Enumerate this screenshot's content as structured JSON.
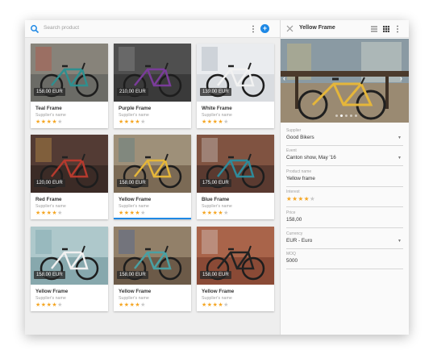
{
  "search": {
    "placeholder": "Search product"
  },
  "icons": {
    "search": "search-icon",
    "more": "more-vert-icon",
    "add": "add-circle-icon",
    "close": "close-icon",
    "list": "list-view-icon",
    "grid": "grid-view-icon"
  },
  "colors": {
    "accent": "#1e88e5",
    "star": "#f5a623",
    "star_off": "#c9c9c9"
  },
  "add_label": "+",
  "products": [
    {
      "price": "158,00 EUR",
      "title": "Teal Frame",
      "supplier": "Supplier's name",
      "rating": 4
    },
    {
      "price": "210,00 EUR",
      "title": "Purple Frame",
      "supplier": "Supplier's name",
      "rating": 4
    },
    {
      "price": "139,00 EUR",
      "title": "White Frame",
      "supplier": "Supplier's name",
      "rating": 4
    },
    {
      "price": "120,00 EUR",
      "title": "Red Frame",
      "supplier": "Supplier's name",
      "rating": 4
    },
    {
      "price": "158,00 EUR",
      "title": "Yellow Frame",
      "supplier": "Supplier's name",
      "rating": 4
    },
    {
      "price": "175,00 EUR",
      "title": "Blue Frame",
      "supplier": "Supplier's name",
      "rating": 4
    },
    {
      "price": "158,00 EUR",
      "title": "Yellow Frame",
      "supplier": "Supplier's name",
      "rating": 4
    },
    {
      "price": "158,00 EUR",
      "title": "Yellow Frame",
      "supplier": "Supplier's name",
      "rating": 4
    },
    {
      "price": "158,00 EUR",
      "title": "Yellow Frame",
      "supplier": "Supplier's name",
      "rating": 4
    }
  ],
  "selected_index": 4,
  "detail": {
    "title": "Yellow Frame",
    "nav_prev": "‹",
    "nav_next": "›",
    "carousel_count": 5,
    "carousel_active": 1,
    "fields": [
      {
        "label": "Supplier",
        "value": "Good Bikers",
        "dropdown": true
      },
      {
        "label": "Event",
        "value": "Canton show, May '16",
        "dropdown": true
      },
      {
        "label": "Product name",
        "value": "Yellow frame",
        "dropdown": false
      },
      {
        "label": "Interest",
        "rating": 4,
        "dropdown": false
      },
      {
        "label": "Price",
        "value": "158,00",
        "dropdown": false
      },
      {
        "label": "Currency",
        "value": "EUR - Euro",
        "dropdown": true
      },
      {
        "label": "MOQ",
        "value": "5000",
        "dropdown": false
      }
    ]
  }
}
